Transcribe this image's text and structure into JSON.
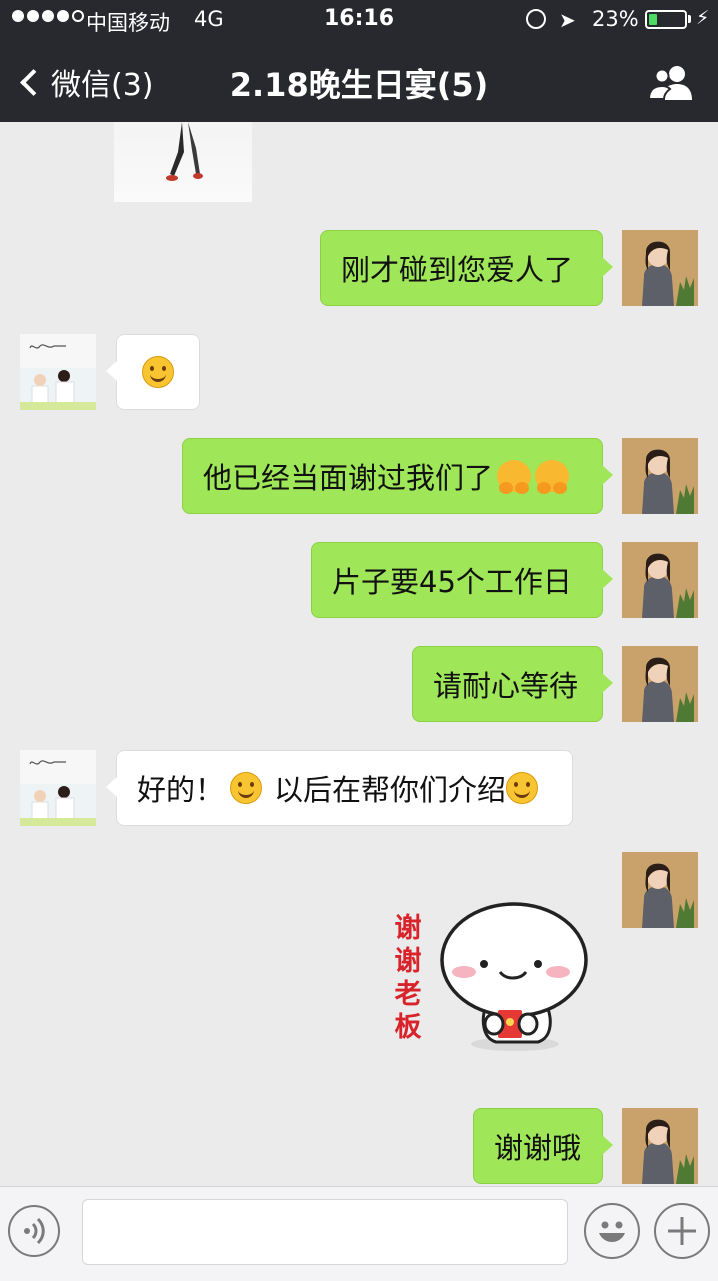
{
  "status_bar": {
    "carrier": "中国移动",
    "network": "4G",
    "time": "16:16",
    "battery_percent": "23%",
    "signal_icon": "signal-dots-icon",
    "lock_icon": "orientation-lock-icon",
    "location_icon": "location-arrow-icon",
    "battery_icon": "battery-charging-icon",
    "battery_level": 0.23,
    "battery_color": "#4cd964"
  },
  "nav": {
    "back_label": "微信(3)",
    "title": "2.18晚生日宴(5)",
    "group_icon": "group-members-icon"
  },
  "colors": {
    "header_bg": "#27292e",
    "chat_bg": "#ebebeb",
    "my_bubble": "#9fe658",
    "friend_bubble": "#ffffff"
  },
  "messages": [
    {
      "sender": "friend",
      "type": "sticker"
    },
    {
      "sender": "me",
      "type": "text",
      "text": "刚才碰到您爱人了"
    },
    {
      "sender": "friend",
      "type": "emoji",
      "emoji": "smile-emoji"
    },
    {
      "sender": "me",
      "type": "text",
      "text": "他已经当面谢过我们了",
      "emojis": [
        "hug-emoji",
        "hug-emoji"
      ]
    },
    {
      "sender": "me",
      "type": "text",
      "text": "片子要45个工作日"
    },
    {
      "sender": "me",
      "type": "text",
      "text": "请耐心等待"
    },
    {
      "sender": "friend",
      "type": "text",
      "text_a": "好的！",
      "text_b": "以后在帮你们介绍",
      "emojis": [
        "smile-emoji",
        "smile-emoji"
      ]
    },
    {
      "sender": "me",
      "type": "sticker",
      "sticker_text": "谢谢老板"
    },
    {
      "sender": "me",
      "type": "text",
      "text": "谢谢哦"
    }
  ],
  "input_bar": {
    "placeholder": "",
    "voice_icon": "voice-input-icon",
    "emoji_icon": "emoji-picker-icon",
    "plus_icon": "more-plus-icon"
  }
}
